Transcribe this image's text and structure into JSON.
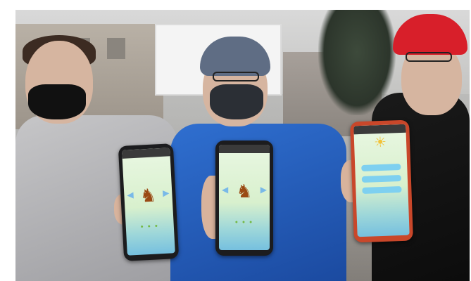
{
  "caption": "",
  "photo": {
    "subjects": [
      {
        "id": "left-boy",
        "wearing": "black-mask"
      },
      {
        "id": "middle-boy",
        "wearing": "grey-mask"
      },
      {
        "id": "right-boy",
        "wearing": "red-cap"
      }
    ],
    "phones": [
      {
        "id": "phone-1",
        "screen_icon": "character-icon"
      },
      {
        "id": "phone-2",
        "screen_icon": "character-icon"
      },
      {
        "id": "phone-3",
        "screen_icon": "sun-icon"
      }
    ]
  },
  "colors": {
    "cap": "#d81f2a",
    "jacket_blue": "#2f6fd0",
    "phone_case_red": "#c9472a",
    "screen_green": "#d8f0cd"
  }
}
